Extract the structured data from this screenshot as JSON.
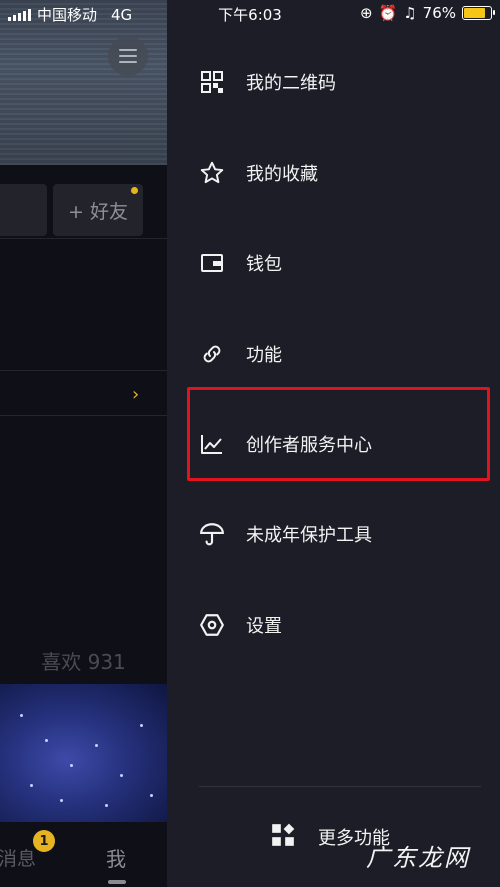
{
  "status_bar": {
    "carrier": "中国移动",
    "network": "4G",
    "time": "下午6:03",
    "battery_percent": "76%",
    "battery_level": 0.76
  },
  "profile": {
    "add_friend_label": "+ 好友",
    "likes_label": "喜欢 931",
    "tabs": {
      "messages": "消息",
      "messages_badge": "1",
      "me": "我"
    }
  },
  "drawer": {
    "items": [
      {
        "label": "我的二维码",
        "icon": "qr-code-icon"
      },
      {
        "label": "我的收藏",
        "icon": "star-icon"
      },
      {
        "label": "钱包",
        "icon": "wallet-icon"
      },
      {
        "label": "功能",
        "icon": "link-icon"
      },
      {
        "label": "创作者服务中心",
        "icon": "chart-icon"
      },
      {
        "label": "未成年保护工具",
        "icon": "umbrella-icon"
      },
      {
        "label": "设置",
        "icon": "hexagon-settings-icon"
      }
    ],
    "more_label": "更多功能",
    "highlight_color": "#e0141e"
  },
  "watermark": "广东龙网"
}
